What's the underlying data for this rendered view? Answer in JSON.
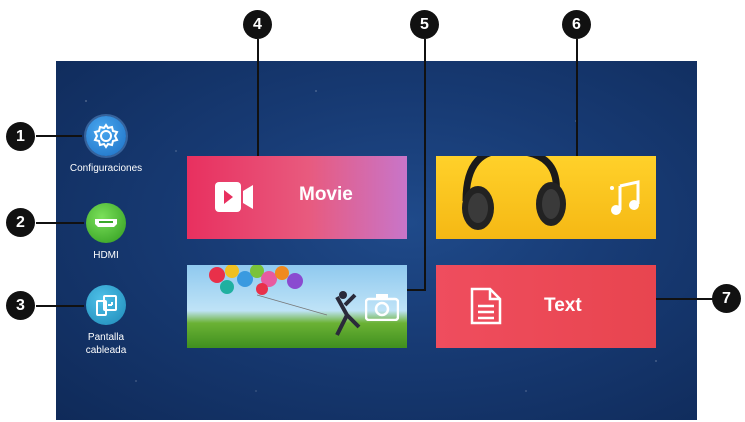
{
  "sidebar": {
    "items": [
      {
        "label": "Configuraciones",
        "icon": "settings-gear-icon"
      },
      {
        "label": "HDMI",
        "icon": "hdmi-icon"
      },
      {
        "label": "Pantalla",
        "label2": "cableada",
        "icon": "screen-cast-icon"
      }
    ]
  },
  "tiles": {
    "movie": {
      "label": "Movie",
      "icon": "video-camera-icon"
    },
    "music": {
      "icon": "music-note-icon"
    },
    "photo": {
      "icon": "camera-icon"
    },
    "text": {
      "label": "Text",
      "icon": "document-icon"
    }
  },
  "callouts": [
    "1",
    "2",
    "3",
    "4",
    "5",
    "6",
    "7"
  ],
  "colors": {
    "background": "#173a73",
    "movie_tile": "#e8305f",
    "music_tile": "#ffd12a",
    "text_tile": "#ef4d5e",
    "callout": "#111111"
  }
}
